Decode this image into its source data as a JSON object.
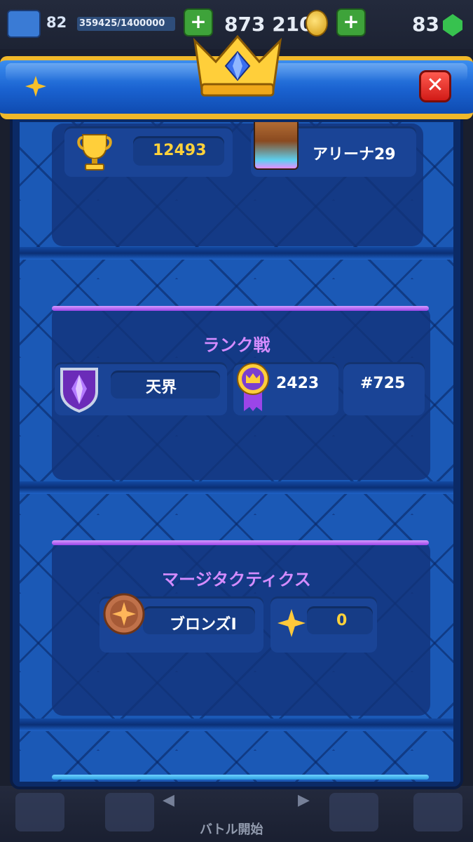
{
  "status_bar": {
    "level": "82",
    "xp": "359425/1400000",
    "gold": "873 210",
    "gems": "83"
  },
  "modal": {
    "close_label": "✕"
  },
  "trophy_row": {
    "trophies": "12493",
    "arena": "アリーナ29"
  },
  "ranked": {
    "title": "ランク戦",
    "league": "天界",
    "rating": "2423",
    "rank": "#725"
  },
  "merge_tactics": {
    "title": "マージタクティクス",
    "tier": "ブロンズI",
    "points": "0"
  },
  "bottom_nav": {
    "battle_label": "バトル開始"
  },
  "colors": {
    "header_gold": "#f0b82a",
    "section_title": "#d48cff",
    "trophy_value": "#ffd23a",
    "close_red": "#d11b17"
  }
}
